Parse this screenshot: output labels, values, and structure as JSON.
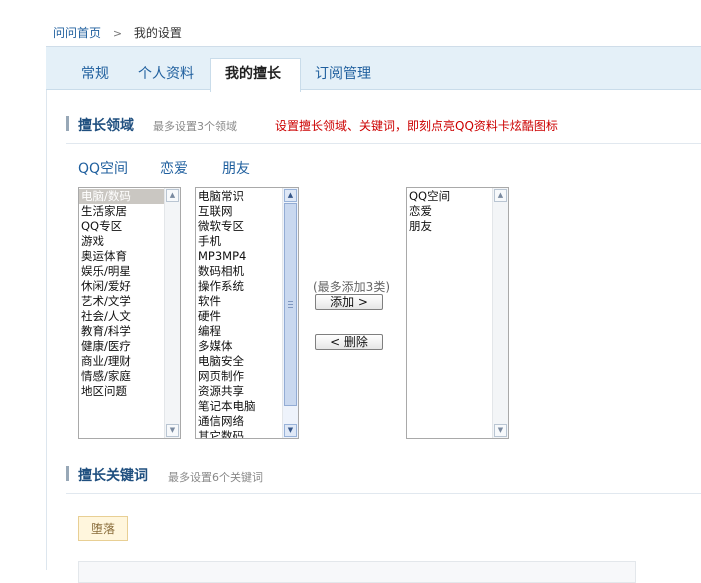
{
  "breadcrumb": {
    "home": "问问首页",
    "sep": ">",
    "current": "我的设置"
  },
  "tabs": [
    {
      "label": "常规"
    },
    {
      "label": "个人资料"
    },
    {
      "label": "我的擅长"
    },
    {
      "label": "订阅管理"
    }
  ],
  "expertise": {
    "title": "擅长领域",
    "hint": "最多设置3个领域",
    "notice": "设置擅长领域、关键词，即刻点亮QQ资料卡炫酷图标",
    "chips": [
      "QQ空间",
      "恋爱",
      "朋友"
    ]
  },
  "category_list": [
    "电脑/数码",
    "生活家居",
    "QQ专区",
    "游戏",
    "奥运体育",
    "娱乐/明星",
    "休闲/爱好",
    "艺术/文学",
    "社会/人文",
    "教育/科学",
    "健康/医疗",
    "商业/理财",
    "情感/家庭",
    "地区问题"
  ],
  "subcategory_list": [
    "电脑常识",
    "互联网",
    "微软专区",
    "手机",
    "MP3MP4",
    "数码相机",
    "操作系统",
    "软件",
    "硬件",
    "编程",
    "多媒体",
    "电脑安全",
    "网页制作",
    "资源共享",
    "笔记本电脑",
    "通信网络",
    "其它数码"
  ],
  "transfer": {
    "limit_note": "(最多添加3类)",
    "add_label": "添加 >",
    "remove_label": "< 删除"
  },
  "selected_list": [
    "QQ空间",
    "恋爱",
    "朋友"
  ],
  "keywords": {
    "title": "擅长关键词",
    "hint": "最多设置6个关键词",
    "tags": [
      "堕落"
    ]
  }
}
